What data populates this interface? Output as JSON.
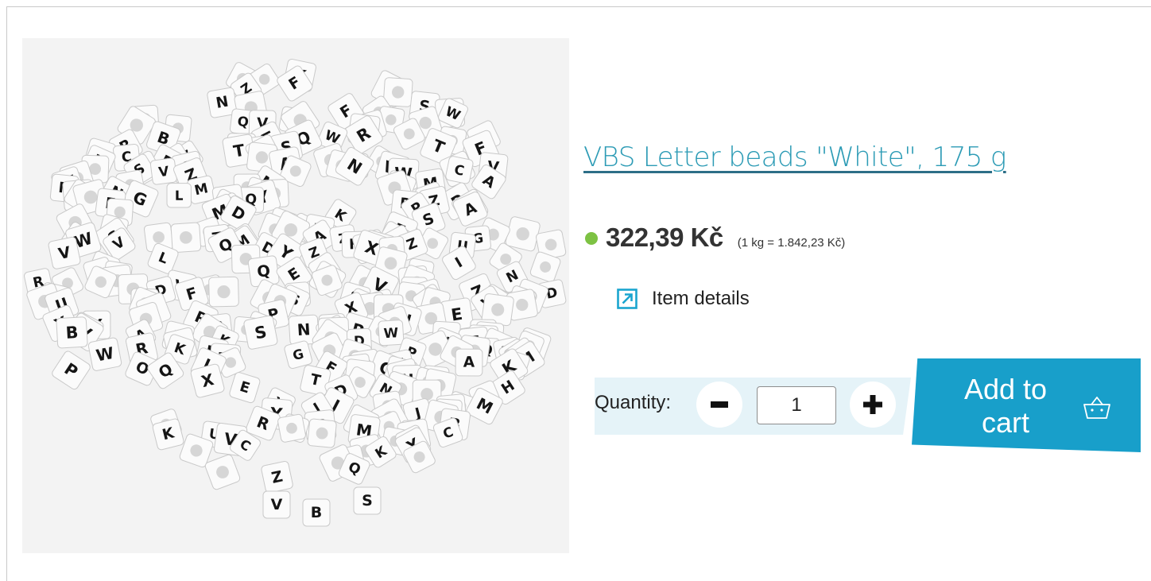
{
  "product": {
    "title": "VBS Letter beads \"White\", 175 g",
    "image_alt": "Letter beads",
    "price": "322,39 Kč",
    "unit_price": "(1 kg = 1.842,23 Kč)",
    "in_stock_color": "#7dc243",
    "details_label": "Item details",
    "details_icon": "external-link-icon"
  },
  "cart": {
    "quantity_label": "Quantity:",
    "quantity_value": "1",
    "minus_icon": "minus-icon",
    "plus_icon": "plus-icon",
    "add_label": "Add to cart",
    "basket_icon": "basket-icon",
    "accent": "#189fca"
  },
  "image_letters": [
    "V",
    "B",
    "S"
  ]
}
